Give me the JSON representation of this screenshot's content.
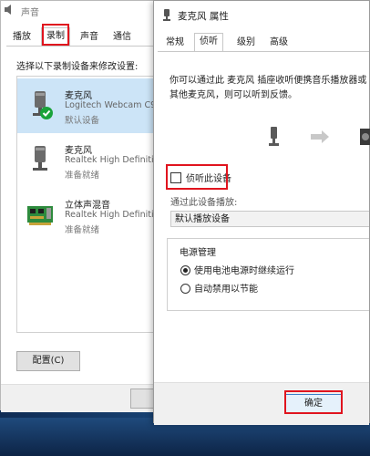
{
  "back_window": {
    "title": "声音",
    "tabs": [
      {
        "label": "播放"
      },
      {
        "label": "录制"
      },
      {
        "label": "声音"
      },
      {
        "label": "通信"
      }
    ],
    "instruction": "选择以下录制设备来修改设置:",
    "devices": [
      {
        "name": "麦克风",
        "detail": "Logitech Webcam C9",
        "status": "默认设备",
        "icon": "microphone-icon",
        "selected": true
      },
      {
        "name": "麦克风",
        "detail": "Realtek High Definitic",
        "status": "准备就绪",
        "icon": "microphone-icon",
        "selected": false
      },
      {
        "name": "立体声混音",
        "detail": "Realtek High Definitic",
        "status": "准备就绪",
        "icon": "circuit-board-icon",
        "selected": false
      }
    ],
    "configure_button": "配置(C)"
  },
  "front_window": {
    "title": "麦克风 属性",
    "tabs": [
      {
        "label": "常规"
      },
      {
        "label": "侦听"
      },
      {
        "label": "级别"
      },
      {
        "label": "高级"
      }
    ],
    "description": "你可以通过此 麦克风 插座收听便携音乐播放器或其他麦克风，则可以听到反馈。",
    "listen_checkbox_label": "侦听此设备",
    "listen_checked": false,
    "playback_label": "通过此设备播放:",
    "playback_device": "默认播放设备",
    "power_group_title": "电源管理",
    "power_options": [
      {
        "label": "使用电池电源时继续运行",
        "selected": true
      },
      {
        "label": "自动禁用以节能",
        "selected": false
      }
    ],
    "ok_button": "确定"
  },
  "colors": {
    "highlight_box": "#e0141e",
    "selection": "#cce4f7",
    "check_badge": "#1aa33a"
  }
}
